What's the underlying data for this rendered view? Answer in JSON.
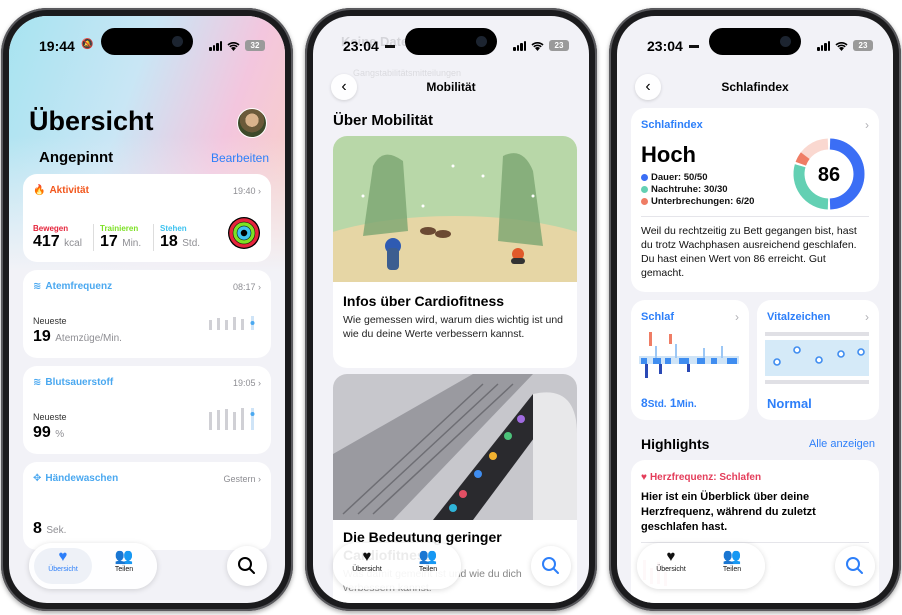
{
  "phone1": {
    "time": "19:44",
    "battery": "32",
    "title": "Übersicht",
    "section": "Angepinnt",
    "edit": "Bearbeiten",
    "activity": {
      "title": "Aktivität",
      "time": "19:40",
      "move_label": "Bewegen",
      "move_value": "417",
      "move_unit": "kcal",
      "exercise_label": "Trainieren",
      "exercise_value": "17",
      "exercise_unit": "Min.",
      "stand_label": "Stehen",
      "stand_value": "18",
      "stand_unit": "Std."
    },
    "respiratory": {
      "title": "Atemfrequenz",
      "time": "08:17",
      "label": "Neueste",
      "value": "19",
      "unit": "Atemzüge/Min."
    },
    "oxygen": {
      "title": "Blutsauerstoff",
      "time": "19:05",
      "label": "Neueste",
      "value": "99",
      "unit": "%"
    },
    "handwash": {
      "title": "Händewaschen",
      "time": "Gestern",
      "value": "8",
      "unit": "Sek."
    },
    "tabs": {
      "summary": "Übersicht",
      "sharing": "Teilen"
    }
  },
  "phone2": {
    "time": "23:04",
    "battery": "23",
    "nav_title": "Mobilität",
    "ghost_title": "Keine Daten vorhanden",
    "ghost_sub": "Gangstabilitätsmitteilungen",
    "section": "Über Mobilität",
    "article1": {
      "title": "Infos über Cardiofitness",
      "body": "Wie gemessen wird, warum dies wichtig ist und wie du deine Werte verbessern kannst."
    },
    "article2": {
      "title": "Die Bedeutung geringer Cardiofitness",
      "body": "Was damit gemeint ist und wie du dich verbessern kannst."
    },
    "tabs": {
      "summary": "Übersicht",
      "sharing": "Teilen"
    }
  },
  "phone3": {
    "time": "23:04",
    "battery": "23",
    "nav_title": "Schlafindex",
    "score_card": {
      "label": "Schlafindex",
      "rating": "Hoch",
      "score": "86",
      "duration": "Dauer: 50/50",
      "rest": "Nachtruhe: 30/30",
      "interruptions": "Unterbrechungen: 6/20",
      "text": "Weil du rechtzeitig zu Bett gegangen bist, hast du trotz Wachphasen ausreichend geschlafen. Du hast einen Wert von 86 erreicht. Gut gemacht.",
      "segments": [
        {
          "name": "Dauer",
          "value": 50,
          "max": 50,
          "color": "#3b6ef5"
        },
        {
          "name": "Nachtruhe",
          "value": 30,
          "max": 30,
          "color": "#63d0b3"
        },
        {
          "name": "Unterbrechungen",
          "value": 6,
          "max": 20,
          "color": "#ef7d65"
        }
      ]
    },
    "sleep": {
      "label": "Schlaf",
      "hours": "8",
      "hours_unit": "Std.",
      "minutes": "1",
      "minutes_unit": "Min."
    },
    "vitals": {
      "label": "Vitalzeichen",
      "status": "Normal"
    },
    "highlights": "Highlights",
    "show_all": "Alle anzeigen",
    "highlight": {
      "title": "Herzfrequenz: Schlafen",
      "text": "Hier ist ein Überblick über deine Herzfrequenz, während du zuletzt geschlafen hast."
    },
    "tabs": {
      "summary": "Übersicht",
      "sharing": "Teilen"
    }
  },
  "colors": {
    "accent": "#2d7ff9",
    "activity": "#f2571d",
    "move": "#e5253c",
    "exercise": "#7de125",
    "stand": "#3fc3f0",
    "teal": "#63d0b3",
    "heart": "#e43d5a"
  }
}
